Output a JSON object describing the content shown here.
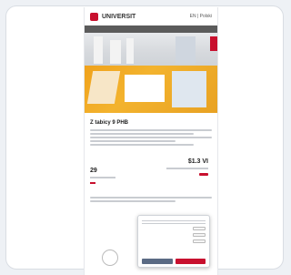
{
  "site": {
    "logo_text": "UNIVERSIT",
    "lang": "EN | Polski"
  },
  "subnav": {
    "items": [
      "",
      "",
      "",
      "",
      ""
    ]
  },
  "content": {
    "heading": "Z tabicy 9 PHB",
    "link1": "",
    "link2": ""
  },
  "prices": {
    "right_value": "$1.3 VI",
    "left_value": "29"
  },
  "cookie": {
    "title": "",
    "row1_label": "",
    "row2_label": "",
    "row3_label": "",
    "save_label": "",
    "accept_label": ""
  }
}
